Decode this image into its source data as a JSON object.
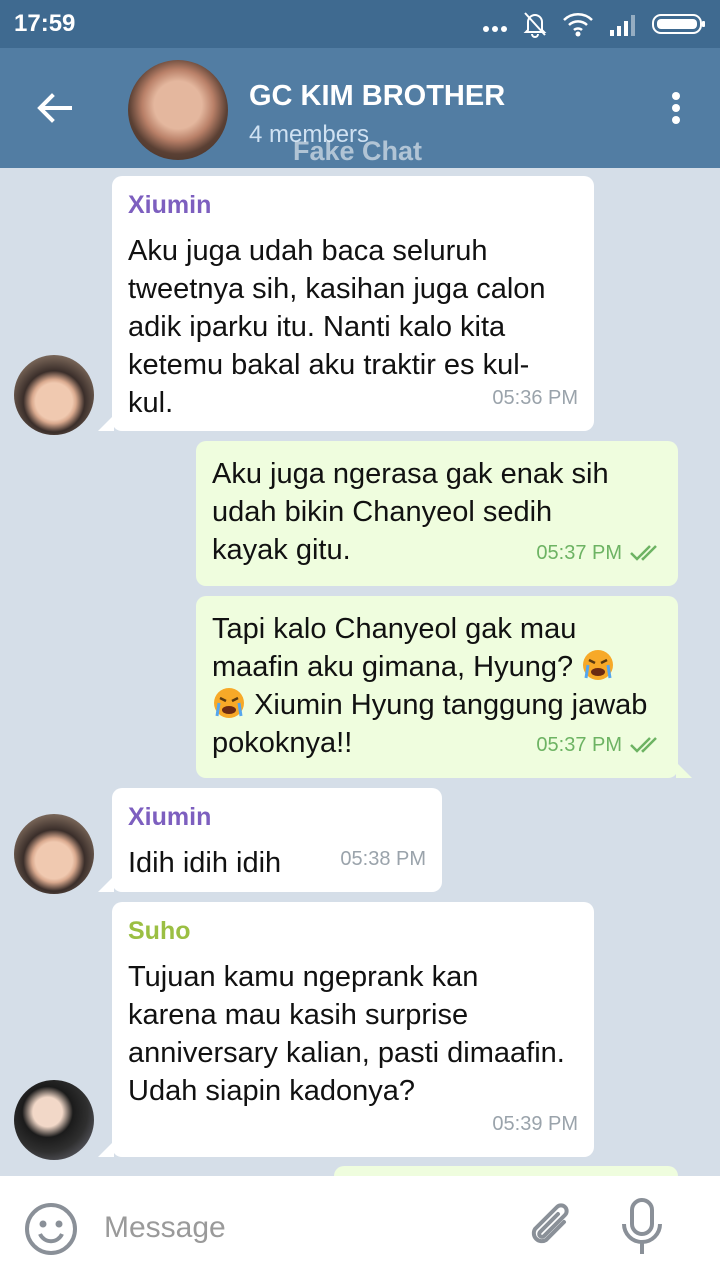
{
  "status_bar": {
    "time": "17:59",
    "icons": [
      "more-dots-icon",
      "bell-off-icon",
      "wifi-icon",
      "signal-icon",
      "battery-icon"
    ]
  },
  "header": {
    "title": "GC KIM BROTHER",
    "subtitle": "4 members",
    "watermark": "Fake Chat",
    "back_icon": "arrow-back-icon",
    "menu_icon": "more-vertical-icon"
  },
  "messages": [
    {
      "direction": "in",
      "sender": "Xiumin",
      "text": "Aku juga udah baca seluruh tweetnya sih, kasihan juga calon adik iparku itu. Nanti kalo kita ketemu bakal aku traktir es kul-kul.",
      "time": "05:36 PM"
    },
    {
      "direction": "out",
      "text": "Aku juga ngerasa gak enak sih udah bikin Chanyeol sedih kayak gitu.",
      "time": "05:37 PM",
      "status": "read"
    },
    {
      "direction": "out",
      "text_before": "Tapi kalo Chanyeol gak mau maafin aku gimana, Hyung?",
      "text_after": "Xiumin Hyung tanggung jawab pokoknya!!",
      "emoji": "crying-face-emoji",
      "time": "05:37 PM",
      "status": "read"
    },
    {
      "direction": "in",
      "sender": "Xiumin",
      "text": "Idih idih idih",
      "time": "05:38 PM"
    },
    {
      "direction": "in",
      "sender": "Suho",
      "text": "Tujuan kamu ngeprank kan karena mau kasih surprise anniversary kalian, pasti dimaafin. Udah siapin kadonya?",
      "time": "05:39 PM"
    }
  ],
  "sender_colors": {
    "Xiumin": "#7d5fbf",
    "Suho": "#9bbf43"
  },
  "input": {
    "placeholder": "Message"
  },
  "colors": {
    "status_bar": "#3f6a90",
    "header": "#527da3",
    "background": "#d5dee8",
    "incoming_bubble": "#ffffff",
    "outgoing_bubble": "#effdde",
    "read_check": "#6db363"
  }
}
